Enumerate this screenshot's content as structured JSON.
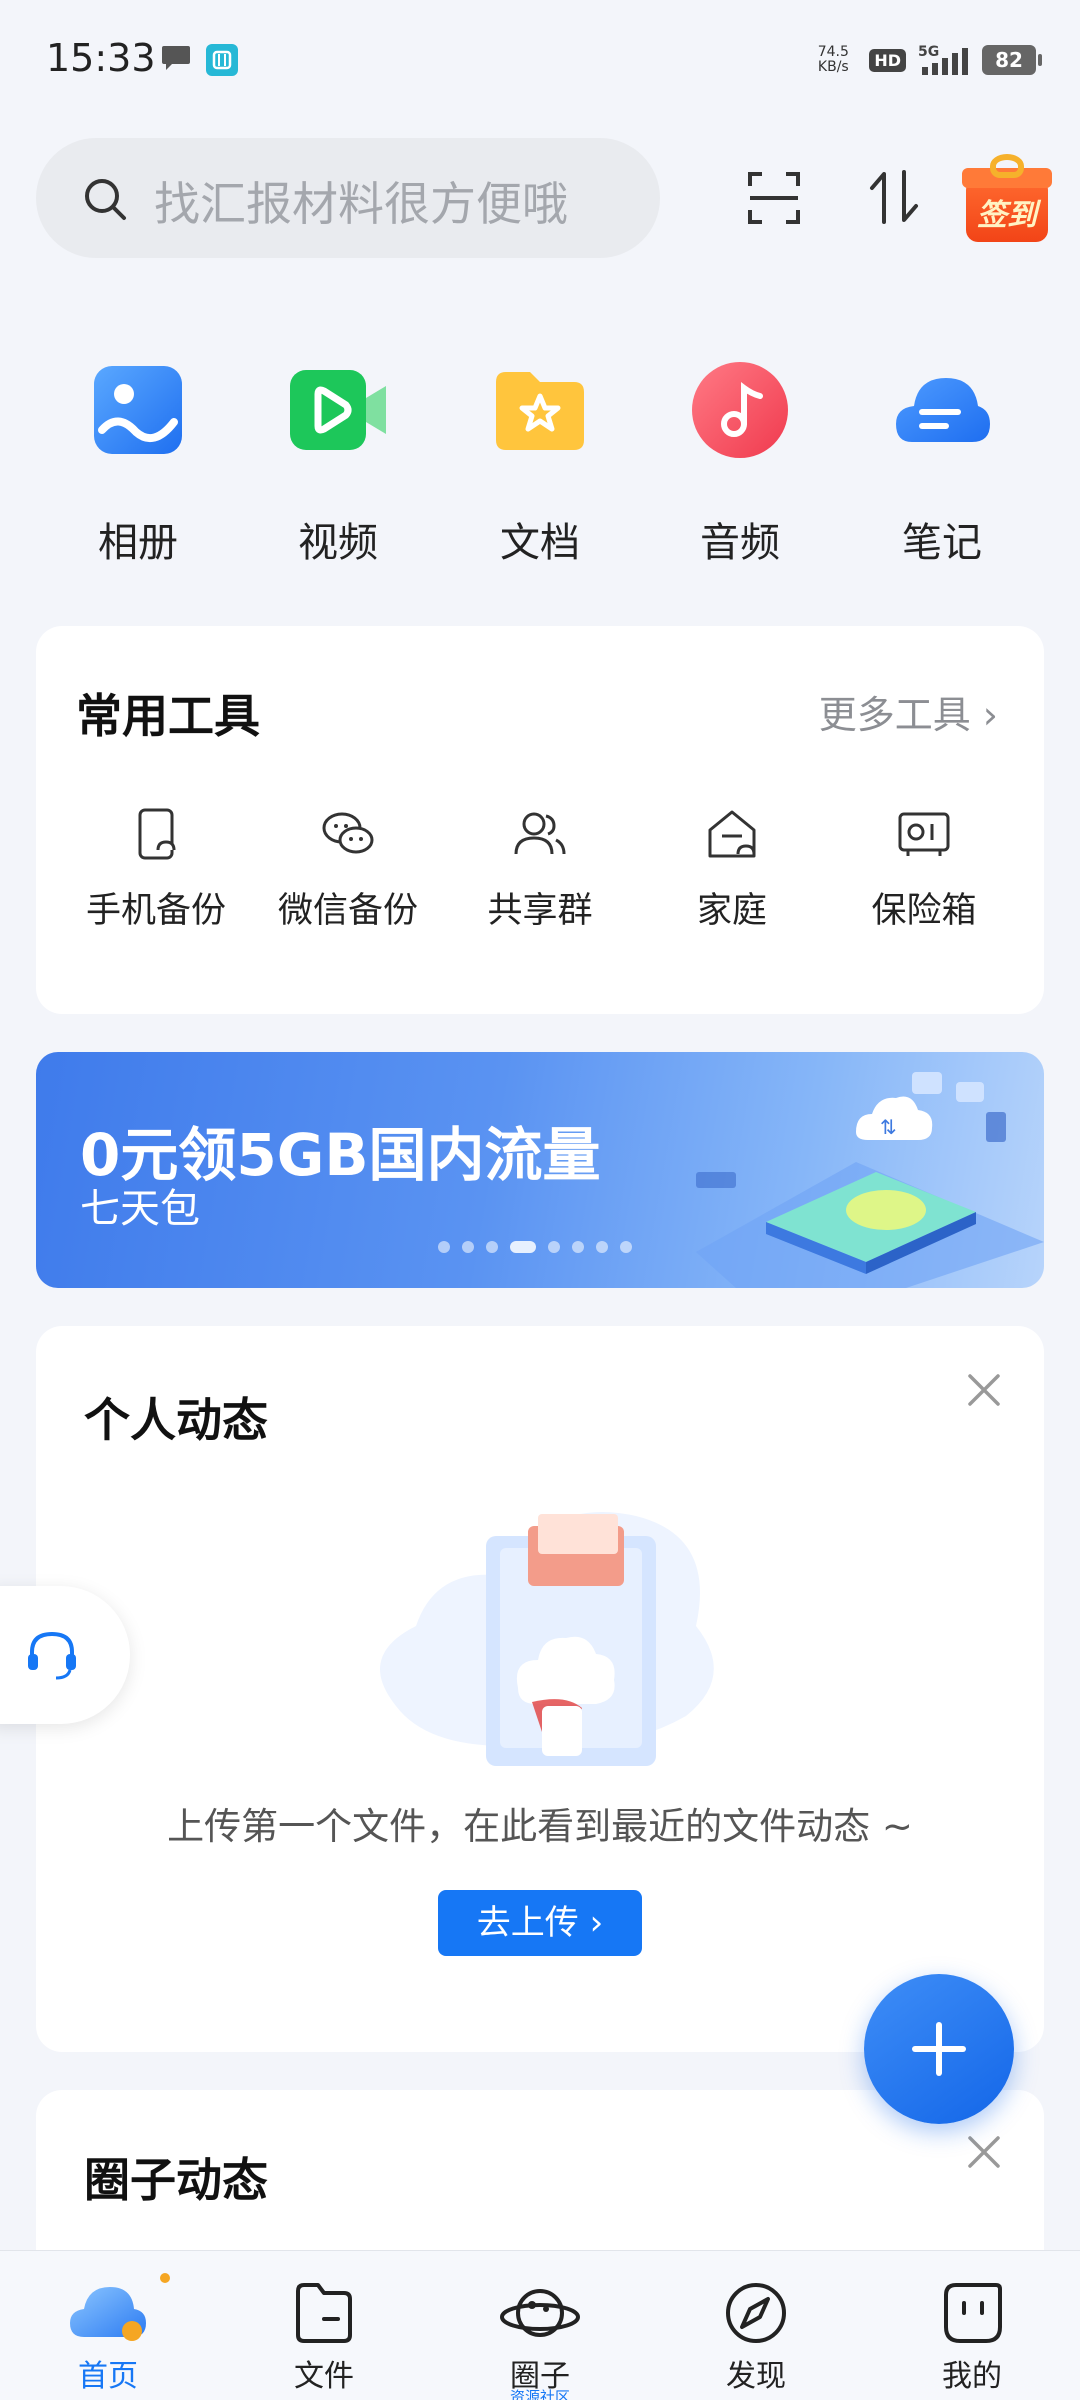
{
  "status_bar": {
    "time": "15:33",
    "net_speed_value": "74.5",
    "net_speed_unit": "KB/s",
    "hd": "HD",
    "network": "5G",
    "battery": "82"
  },
  "search": {
    "placeholder": "找汇报材料很方便哦"
  },
  "header": {
    "checkin_label": "签到"
  },
  "categories": [
    {
      "label": "相册",
      "icon": "photo-album-icon"
    },
    {
      "label": "视频",
      "icon": "video-icon"
    },
    {
      "label": "文档",
      "icon": "document-folder-icon"
    },
    {
      "label": "音频",
      "icon": "audio-icon"
    },
    {
      "label": "笔记",
      "icon": "note-cloud-icon"
    }
  ],
  "tools": {
    "title": "常用工具",
    "more": "更多工具",
    "items": [
      {
        "label": "手机备份",
        "icon": "phone-backup-icon"
      },
      {
        "label": "微信备份",
        "icon": "wechat-backup-icon"
      },
      {
        "label": "共享群",
        "icon": "shared-group-icon"
      },
      {
        "label": "家庭",
        "icon": "family-icon"
      },
      {
        "label": "保险箱",
        "icon": "safe-box-icon"
      }
    ]
  },
  "banner": {
    "title": "0元领5GB国内流量",
    "subtitle": "七天包",
    "total_slides": 8,
    "active_slide": 4
  },
  "personal_activity": {
    "title": "个人动态",
    "empty_text": "上传第一个文件，在此看到最近的文件动态 ~",
    "upload_button": "去上传"
  },
  "circle_activity": {
    "title": "圈子动态"
  },
  "bottom_nav": {
    "items": [
      {
        "label": "首页",
        "icon": "home-cloud-icon",
        "active": true
      },
      {
        "label": "文件",
        "icon": "file-folder-icon"
      },
      {
        "label": "圈子",
        "icon": "planet-icon",
        "sub": "资源社区"
      },
      {
        "label": "发现",
        "icon": "compass-icon"
      },
      {
        "label": "我的",
        "icon": "profile-face-icon"
      }
    ]
  },
  "colors": {
    "accent": "#1677F5",
    "background": "#F3F5FA",
    "card": "#FFFFFF"
  }
}
